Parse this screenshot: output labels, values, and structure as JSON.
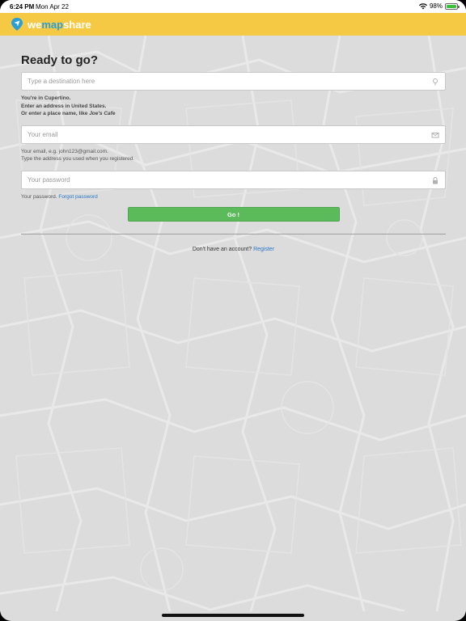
{
  "status_bar": {
    "time": "6:24 PM",
    "date": "Mon Apr 22",
    "battery_percent": "98%",
    "battery_level": 0.98,
    "wifi_icon": "wifi-icon",
    "battery_icon": "battery-icon"
  },
  "header": {
    "logo_icon": "map-pin-logo-icon",
    "logo_we": "we",
    "logo_map": "map",
    "logo_share": "share"
  },
  "form": {
    "title": "Ready to go?",
    "destination": {
      "placeholder": "Type a destination here",
      "value": "",
      "icon": "location-pin-icon"
    },
    "destination_help": {
      "line1": "You're in Cupertino.",
      "line2": "Enter an address in United States.",
      "line3_prefix": "Or enter a place name, like ",
      "line3_example": "Joe's Cafe"
    },
    "email": {
      "placeholder": "Your email",
      "value": "",
      "icon": "envelope-icon"
    },
    "email_help": {
      "line1": "Your email, e.g. john123@gmail.com.",
      "line2": "Type the address you used when you registered."
    },
    "password": {
      "placeholder": "Your password",
      "value": "",
      "icon": "lock-icon"
    },
    "password_help": {
      "prefix": "Your password. ",
      "forgot_link": "Forgot password"
    },
    "go_button": "Go !",
    "register": {
      "prefix": "Don't have an account? ",
      "link": "Register"
    }
  },
  "colors": {
    "header_bg": "#f6c944",
    "button_green": "#5bbb5b",
    "link_blue": "#2a78c8",
    "logo_blue": "#2a9fd6"
  }
}
